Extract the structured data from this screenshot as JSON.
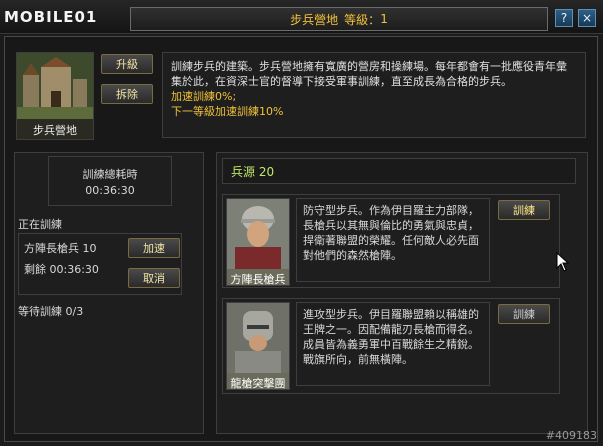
{
  "brand": {
    "logo_text": "MOBILE01"
  },
  "window": {
    "title": "步兵營地",
    "level_label": "等級：",
    "level": "1"
  },
  "icons": {
    "help": "?",
    "close": "×",
    "cursor": "arrow-cursor"
  },
  "building": {
    "name": "步兵營地",
    "upgrade_label": "升級",
    "demolish_label": "拆除",
    "description": "訓練步兵的建築。步兵營地擁有寬廣的營房和操練場。每年都會有一批應役青年彙集於此，在資深士官的督導下接受軍事訓練，直至成長為合格的步兵。",
    "speed_line": "加速訓練0%;",
    "next_speed_line": "下一等級加速訓練10%"
  },
  "left": {
    "total_time_label": "訓練總耗時",
    "total_time": "00:36:30",
    "training_now_label": "正在訓練",
    "current_unit": "方陣長槍兵 10",
    "remaining": "剩餘 00:36:30",
    "speedup_label": "加速",
    "cancel_label": "取消",
    "queue_label": "等待訓練 0/3"
  },
  "right": {
    "source_label": "兵源 20",
    "units": [
      {
        "name": "方陣長槍兵",
        "desc": "防守型步兵。作為伊目羅主力部隊，長槍兵以其無與倫比的勇氣與忠貞，捍衛著聯盟的榮耀。任何敵人必先面對他們的森然槍陣。",
        "button": "訓練",
        "enabled": true
      },
      {
        "name": "龍槍突擊團",
        "desc": "進攻型步兵。伊目羅聯盟賴以稱雄的王牌之一。因配備龍刃長槍而得名。成員皆為義勇軍中百戰餘生之精銳。戰旗所向，前無橫陣。",
        "button": "訓練",
        "enabled": false
      }
    ]
  },
  "watermark": "#409183"
}
